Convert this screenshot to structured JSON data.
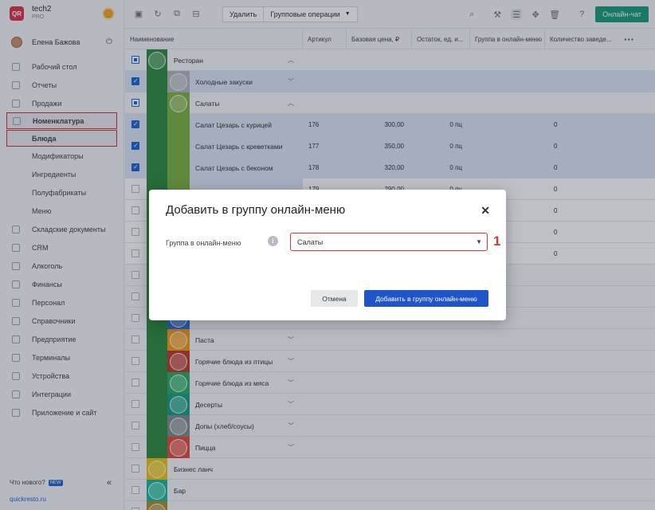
{
  "app": {
    "logo": "QR",
    "name": "tech2",
    "plan": "PRO",
    "theme_icon": "sun-icon"
  },
  "user": {
    "name": "Елена Бажова"
  },
  "sidebar": {
    "items": [
      {
        "label": "Рабочий стол",
        "icon": "dashboard-icon"
      },
      {
        "label": "Отчеты",
        "icon": "reports-icon"
      },
      {
        "label": "Продажи",
        "icon": "sales-icon"
      },
      {
        "label": "Номенклатура",
        "icon": "link-icon"
      }
    ],
    "subitems": [
      "Блюда",
      "Модификаторы",
      "Ингредиенты",
      "Полуфабрикаты",
      "Меню"
    ],
    "items2": [
      {
        "label": "Складские документы",
        "icon": "warehouse-icon"
      },
      {
        "label": "CRM",
        "icon": "crm-icon"
      },
      {
        "label": "Алкоголь",
        "icon": "glass-icon"
      },
      {
        "label": "Финансы",
        "icon": "finance-icon"
      },
      {
        "label": "Персонал",
        "icon": "staff-icon"
      },
      {
        "label": "Справочники",
        "icon": "book-icon"
      },
      {
        "label": "Предприятие",
        "icon": "company-icon"
      },
      {
        "label": "Терминалы",
        "icon": "terminal-icon"
      },
      {
        "label": "Устройства",
        "icon": "device-icon"
      },
      {
        "label": "Интеграции",
        "icon": "integration-icon"
      },
      {
        "label": "Приложение и сайт",
        "icon": "app-icon"
      }
    ],
    "whatsnew": "Что нового?",
    "new_badge": "NEW",
    "site": "quickresto.ru"
  },
  "toolbar": {
    "delete_label": "Удалить",
    "group_ops_label": "Групповые операции",
    "chat_label": "Онлайн-чат"
  },
  "table": {
    "headers": [
      "Наименование",
      "Артикул",
      "Базовая цена, ₽",
      "Остаток, ед. и...",
      "Группа в онлайн-меню",
      "Количество заведе..."
    ],
    "rows": [
      {
        "name": "Ресторан",
        "level": 0,
        "check": "part",
        "color": "#2e8b3e"
      },
      {
        "name": "Холодные закуски",
        "level": 1,
        "check": "on",
        "color": "#b3b7bd"
      },
      {
        "name": "Салаты",
        "level": 1,
        "check": "part",
        "color": "#7cb342"
      },
      {
        "name": "Салат Цезарь с курицей",
        "level": 2,
        "check": "on",
        "sku": "176",
        "price": "300,00",
        "stock": "0 пц",
        "qty": "0"
      },
      {
        "name": "Салат Цезарь с креветками",
        "level": 2,
        "check": "on",
        "sku": "177",
        "price": "350,00",
        "stock": "0 пц",
        "qty": "0"
      },
      {
        "name": "Салат Цезарь с беконом",
        "level": 2,
        "check": "on",
        "sku": "178",
        "price": "320,00",
        "stock": "0 пц",
        "qty": "0"
      },
      {
        "name": "",
        "level": 2,
        "check": "off",
        "sku": "179",
        "price": "290,00",
        "stock": "0 пц",
        "qty": "0"
      },
      {
        "name": "",
        "level": 2,
        "check": "off",
        "stock": "0 пц",
        "qty": "0"
      },
      {
        "name": "",
        "level": 2,
        "check": "off",
        "stock": "0 пц",
        "qty": "0"
      },
      {
        "name": "",
        "level": 2,
        "check": "off",
        "stock": "0 пц",
        "qty": "0"
      },
      {
        "name": "",
        "level": 1,
        "check": "off",
        "color": "#8e44ad"
      },
      {
        "name": "",
        "level": 1,
        "check": "off",
        "color": "#1f8fd1"
      },
      {
        "name": "",
        "level": 1,
        "check": "off",
        "color": "#2f6fd8"
      },
      {
        "name": "Паста",
        "level": 1,
        "check": "off",
        "color": "#f39c12"
      },
      {
        "name": "Горячие блюда из птицы",
        "level": 1,
        "check": "off",
        "color": "#c0392b"
      },
      {
        "name": "Горячие блюда из мяса",
        "level": 1,
        "check": "off",
        "color": "#27ae60"
      },
      {
        "name": "Десерты",
        "level": 1,
        "check": "off",
        "color": "#16a085"
      },
      {
        "name": "Допы (хлеб/соусы)",
        "level": 1,
        "check": "off",
        "color": "#7f8c8d"
      },
      {
        "name": "Пицца",
        "level": 1,
        "check": "off",
        "color": "#e74c3c"
      },
      {
        "name": "Бизнес ланч",
        "level": 0,
        "check": "off",
        "color": "#f1c40f"
      },
      {
        "name": "Бар",
        "level": 0,
        "check": "off",
        "color": "#1abc9c"
      },
      {
        "name": "",
        "level": 0,
        "check": "off",
        "color": "#b08c2a"
      }
    ]
  },
  "dialog": {
    "title": "Добавить в группу онлайн-меню",
    "field_label": "Группа в онлайн-меню",
    "selected": "Салаты",
    "marker": "1",
    "cancel": "Отмена",
    "submit": "Добавить в группу онлайн-меню"
  }
}
